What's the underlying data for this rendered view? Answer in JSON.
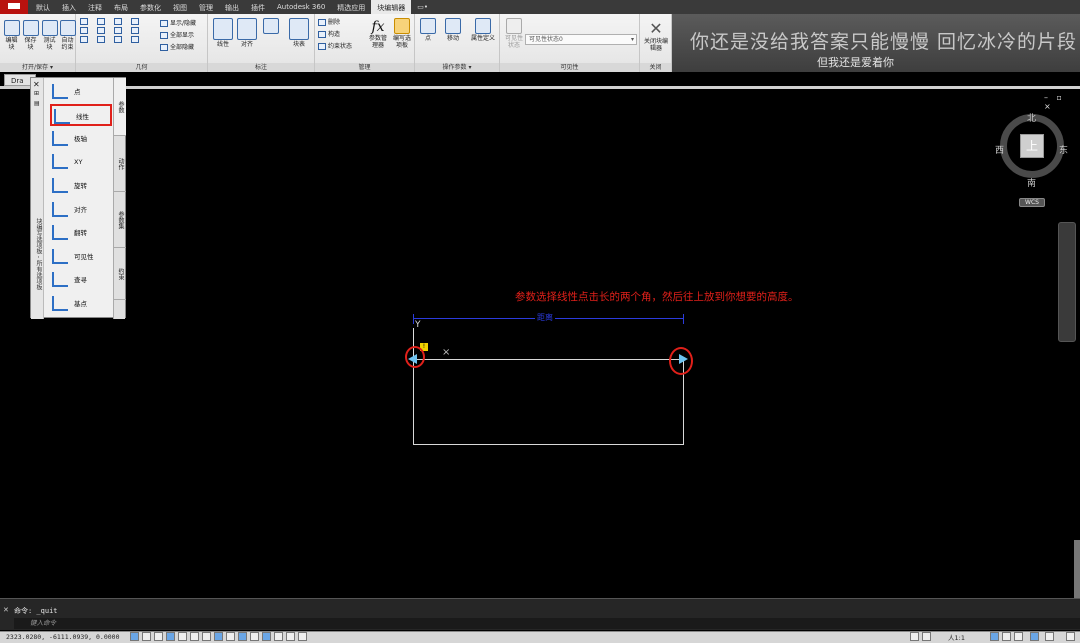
{
  "menubar": {
    "tabs": [
      "默认",
      "插入",
      "注释",
      "布局",
      "参数化",
      "视图",
      "管理",
      "输出",
      "插件",
      "Autodesk 360",
      "精选应用",
      "块编辑器"
    ],
    "active_tab": "块编辑器",
    "extra": "▭•"
  },
  "ribbon": {
    "groups": {
      "open_save": {
        "title": "打开/保存 ▾",
        "buttons": [
          "编辑块",
          "保存块",
          "测试块",
          "自动约束"
        ]
      },
      "geometry": {
        "title": "几何",
        "items": [
          "显示/隐藏",
          "全部显示",
          "全部隐藏"
        ]
      },
      "dimension": {
        "title": "标注",
        "buttons": [
          "线性",
          "对齐",
          "块表"
        ]
      },
      "manage": {
        "title": "管理",
        "items": [
          "删除",
          "构造",
          "约束状态"
        ],
        "buttons": [
          "参数管理器",
          "编写选项板"
        ]
      },
      "action_params": {
        "title": "操作参数 ▾",
        "buttons": [
          "点",
          "移动",
          "属性定义"
        ]
      },
      "visibility": {
        "title": "可见性",
        "state_button": "可见性状态",
        "dropdown": "可见性状态0"
      },
      "close": {
        "title": "关闭",
        "button": "关闭块编辑器"
      }
    }
  },
  "banner": {
    "line1": "你还是没给我答案只能慢慢 回忆冰冷的片段",
    "line2": "但我还是爱着你"
  },
  "document": {
    "tab": "Dra"
  },
  "palette": {
    "side_title": "块编写选项板 - 所有选项板",
    "tabs": [
      "参数",
      "动作",
      "参数集",
      "约束"
    ],
    "items": [
      {
        "label": "点",
        "icon": "point-param-icon"
      },
      {
        "label": "线性",
        "icon": "linear-param-icon"
      },
      {
        "label": "极轴",
        "icon": "polar-param-icon"
      },
      {
        "label": "XY",
        "icon": "xy-param-icon"
      },
      {
        "label": "旋转",
        "icon": "rotation-param-icon"
      },
      {
        "label": "对齐",
        "icon": "alignment-param-icon"
      },
      {
        "label": "翻转",
        "icon": "flip-param-icon"
      },
      {
        "label": "可见性",
        "icon": "visibility-param-icon"
      },
      {
        "label": "查寻",
        "icon": "lookup-param-icon"
      },
      {
        "label": "基点",
        "icon": "basepoint-param-icon"
      }
    ],
    "highlighted": "线性"
  },
  "canvas": {
    "instruction": "参数选择线性点击长的两个角，然后往上放到你想要的高度。",
    "dimension_label": "距离",
    "ucs_y": "Y",
    "warning_badge": "!"
  },
  "viewcube": {
    "top": "上",
    "north": "北",
    "south": "南",
    "east": "东",
    "west": "西",
    "wcs": "WCS"
  },
  "window_controls": "– ▫ ×",
  "command": {
    "history": "命令: _quit",
    "prompt": "键入命令"
  },
  "status": {
    "coordinates": "2323.0280,  -6111.0939, 0.0000",
    "scale": "人1:1"
  }
}
